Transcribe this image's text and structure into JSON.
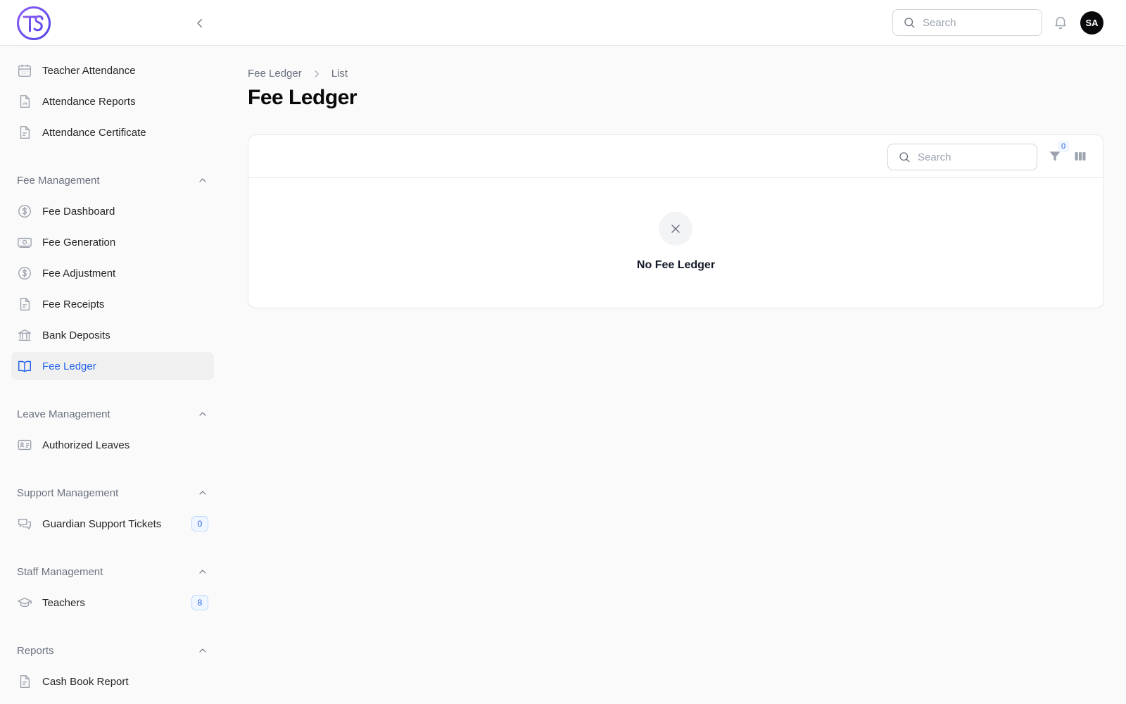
{
  "header": {
    "logo_text": "TS",
    "search_placeholder": "Search",
    "avatar_initials": "SA"
  },
  "sidebar": {
    "items_top": [
      {
        "label": "Teacher Attendance",
        "icon": "calendar-icon"
      },
      {
        "label": "Attendance Reports",
        "icon": "report-file-icon"
      },
      {
        "label": "Attendance Certificate",
        "icon": "document-icon"
      }
    ],
    "fee_section": {
      "title": "Fee Management",
      "items": [
        {
          "label": "Fee Dashboard",
          "icon": "dollar-circle-icon"
        },
        {
          "label": "Fee Generation",
          "icon": "banknote-icon"
        },
        {
          "label": "Fee Adjustment",
          "icon": "dollar-circle-icon"
        },
        {
          "label": "Fee Receipts",
          "icon": "document-icon"
        },
        {
          "label": "Bank Deposits",
          "icon": "bank-icon"
        },
        {
          "label": "Fee Ledger",
          "icon": "book-open-icon",
          "active": true
        }
      ]
    },
    "leave_section": {
      "title": "Leave Management",
      "items": [
        {
          "label": "Authorized Leaves",
          "icon": "id-card-icon"
        }
      ]
    },
    "support_section": {
      "title": "Support Management",
      "items": [
        {
          "label": "Guardian Support Tickets",
          "icon": "chat-bubbles-icon",
          "badge": "0"
        }
      ]
    },
    "staff_section": {
      "title": "Staff Management",
      "items": [
        {
          "label": "Teachers",
          "icon": "graduation-cap-icon",
          "badge": "8"
        }
      ]
    },
    "reports_section": {
      "title": "Reports",
      "items": [
        {
          "label": "Cash Book Report",
          "icon": "document-icon"
        }
      ]
    }
  },
  "breadcrumb": {
    "parent": "Fee Ledger",
    "current": "List"
  },
  "page": {
    "title": "Fee Ledger"
  },
  "table": {
    "search_placeholder": "Search",
    "filter_count": "0",
    "empty_message": "No Fee Ledger"
  },
  "colors": {
    "accent": "#2563eb",
    "logo_gradient_start": "#7c3aed",
    "logo_gradient_end": "#2563eb"
  }
}
